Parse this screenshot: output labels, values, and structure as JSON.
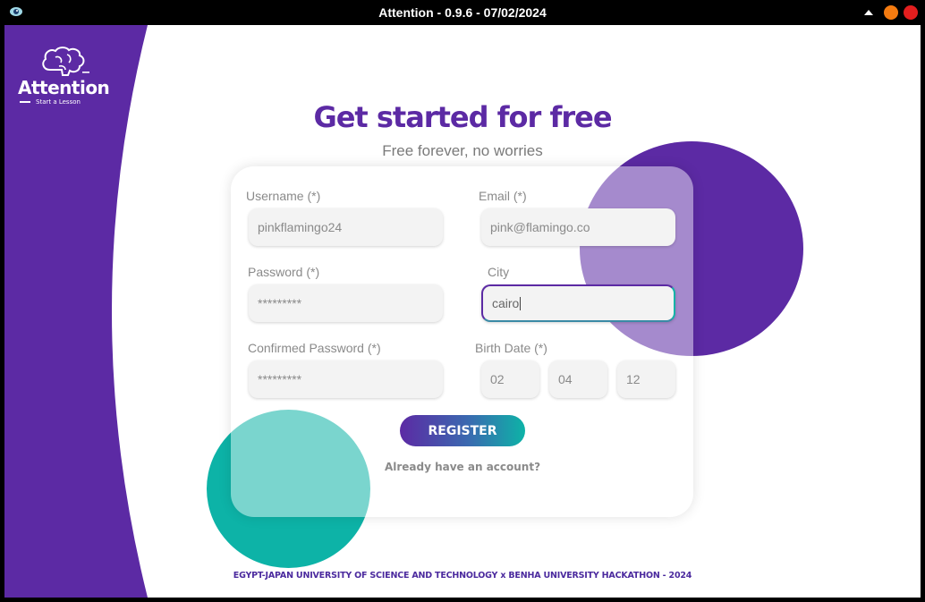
{
  "window": {
    "title": "Attention - 0.9.6 - 07/02/2024"
  },
  "logo": {
    "name": "Attention",
    "tagline": "Start a Lesson"
  },
  "header": {
    "title": "Get started for free",
    "subtitle": "Free forever, no worries"
  },
  "form": {
    "username": {
      "label": "Username (*)",
      "value": "pinkflamingo24"
    },
    "email": {
      "label": "Email (*)",
      "value": "pink@flamingo.co"
    },
    "password": {
      "label": "Password (*)",
      "value": "*********"
    },
    "city": {
      "label": "City",
      "value": "cairo"
    },
    "confirm_password": {
      "label": "Confirmed Password (*)",
      "value": "*********"
    },
    "birth_date": {
      "label": "Birth Date (*)",
      "day": "02",
      "month": "04",
      "year": "12"
    },
    "register_label": "REGISTER",
    "login_link": "Already have an account?"
  },
  "footer": {
    "text": "EGYPT-JAPAN UNIVERSITY OF SCIENCE AND TECHNOLOGY x BENHA UNIVERSITY HACKATHON - 2024"
  },
  "colors": {
    "purple": "#5c2aa4",
    "teal": "#0db3a7",
    "orange": "#f47b10",
    "red": "#e31e1e"
  },
  "icons": [
    "app-eye-icon",
    "brain-icon",
    "minimize-caret-icon"
  ]
}
